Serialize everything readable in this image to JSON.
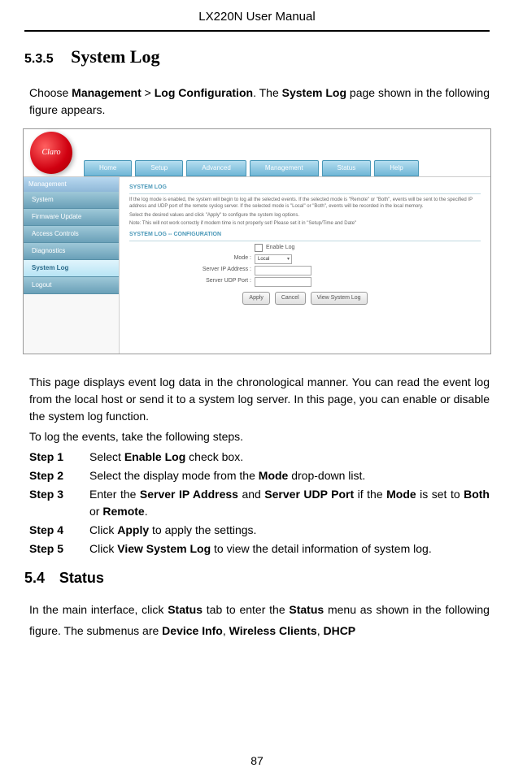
{
  "header": {
    "title": "LX220N User Manual"
  },
  "section": {
    "num": "5.3.5",
    "label": "System Log"
  },
  "intro_parts": {
    "p1": "Choose ",
    "b1": "Management",
    "p2": " > ",
    "b2": "Log Configuration",
    "p3": ". The ",
    "b3": "System Log",
    "p4": " page shown in the following figure appears."
  },
  "screenshot": {
    "logo_text": "Claro",
    "nav": [
      "Home",
      "Setup",
      "Advanced",
      "Management",
      "Status",
      "Help"
    ],
    "side_header": "Management",
    "sidebar": [
      "System",
      "Firmware Update",
      "Access Controls",
      "Diagnostics",
      "System Log",
      "Logout"
    ],
    "sidebar_active_index": 4,
    "panel1_title": "SYSTEM LOG",
    "panel1_lines": [
      "If the log mode is enabled, the system will begin to log all the selected events. If the selected mode is \"Remote\" or \"Both\", events will be sent to the specified IP address and UDP port of the remote syslog server. If the selected mode is \"Local\" or \"Both\", events will be recorded in the local memory.",
      "Select the desired values and click \"Apply\" to configure the system log options.",
      "Note: This will not work correctly if modem time is not properly set! Please set it in \"Setup/Time and Date\""
    ],
    "panel2_title": "SYSTEM LOG -- CONFIGURATION",
    "form": {
      "enable_label": "Enable Log",
      "mode_label": "Mode :",
      "mode_value": "Local",
      "ip_label": "Server IP Address :",
      "port_label": "Server UDP Port :"
    },
    "buttons": [
      "Apply",
      "Cancel",
      "View System Log"
    ]
  },
  "desc": "This page displays event log data in the chronological manner. You can read the event log from the local host or send it to a system log server. In this page, you can enable or disable the system log function.",
  "steps_intro": "To log the events, take the following steps.",
  "steps": [
    {
      "n": "Step 1",
      "pre": "Select ",
      "b1": "Enable Log",
      "post": " check box."
    },
    {
      "n": "Step 2",
      "pre": "Select the display mode from the ",
      "b1": "Mode",
      "post": " drop-down list."
    },
    {
      "n": "Step 3",
      "pre": "Enter the ",
      "b1": "Server IP Address",
      "mid": " and ",
      "b2": "Server UDP Port",
      "mid2": " if the ",
      "b3": "Mode",
      "mid3": " is set to ",
      "b4": "Both",
      "mid4": " or ",
      "b5": "Remote",
      "post": "."
    },
    {
      "n": "Step 4",
      "pre": "Click ",
      "b1": "Apply",
      "post": " to apply the settings."
    },
    {
      "n": "Step 5",
      "pre": "Click ",
      "b1": "View System Log",
      "post": " to view the detail information of system log."
    }
  ],
  "section54": {
    "num": "5.4",
    "label": "Status"
  },
  "status_intro": {
    "p1": "In the main interface, click ",
    "b1": "Status",
    "p2": " tab to enter the ",
    "b2": "Status",
    "p3": " menu as shown in the following figure. The submenus are ",
    "b3": "Device Info",
    "p4": ", ",
    "b4": "Wireless Clients",
    "p5": ", ",
    "b5": "DHCP"
  },
  "page_number": "87"
}
